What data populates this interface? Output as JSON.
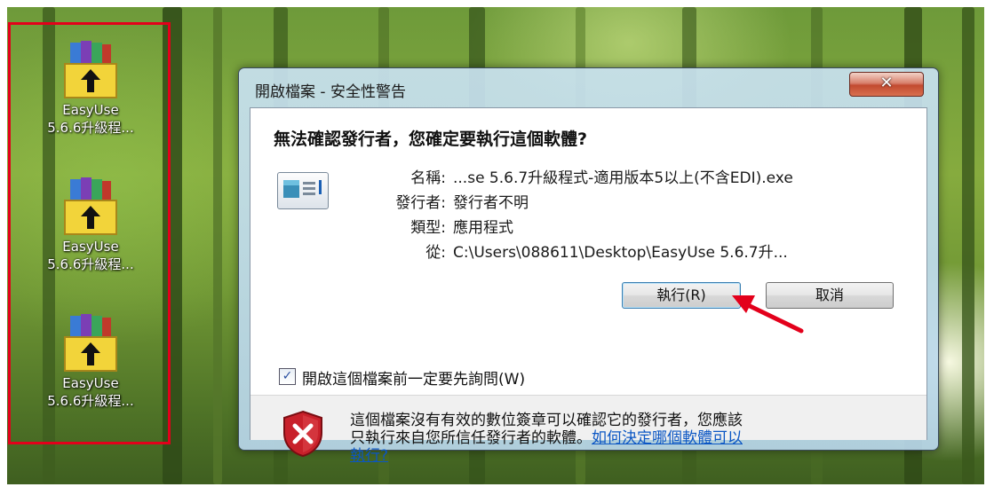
{
  "desktop": {
    "icons": [
      {
        "line1": "EasyUse",
        "line2": "5.6.6升級程..."
      },
      {
        "line1": "EasyUse",
        "line2": "5.6.6升級程..."
      },
      {
        "line1": "EasyUse",
        "line2": "5.6.6升級程..."
      }
    ]
  },
  "dialog": {
    "title": "開啟檔案 - 安全性警告",
    "close_glyph": "✕",
    "heading": "無法確認發行者，您確定要執行這個軟體?",
    "rows": [
      {
        "key": "名稱:",
        "value": "...se 5.6.7升級程式-適用版本5以上(不含EDI).exe"
      },
      {
        "key": "發行者:",
        "value": "發行者不明"
      },
      {
        "key": "類型:",
        "value": "應用程式"
      },
      {
        "key": "從:",
        "value": "C:\\Users\\088611\\Desktop\\EasyUse 5.6.7升..."
      }
    ],
    "run_button": "執行(R)",
    "cancel_button": "取消",
    "checkbox_checked": true,
    "checkbox_label": "開啟這個檔案前一定要先詢問(W)",
    "footer_text_line1": "這個檔案沒有有效的數位簽章可以確認它的發行者，您應該",
    "footer_text_line2": "只執行來自您所信任發行者的軟體。",
    "footer_link_part1": "如何決定哪個軟體可以",
    "footer_link_part2": "執行?"
  },
  "colors": {
    "highlight_box": "#e3001b",
    "arrow": "#e3001b",
    "link": "#0b56c4"
  }
}
